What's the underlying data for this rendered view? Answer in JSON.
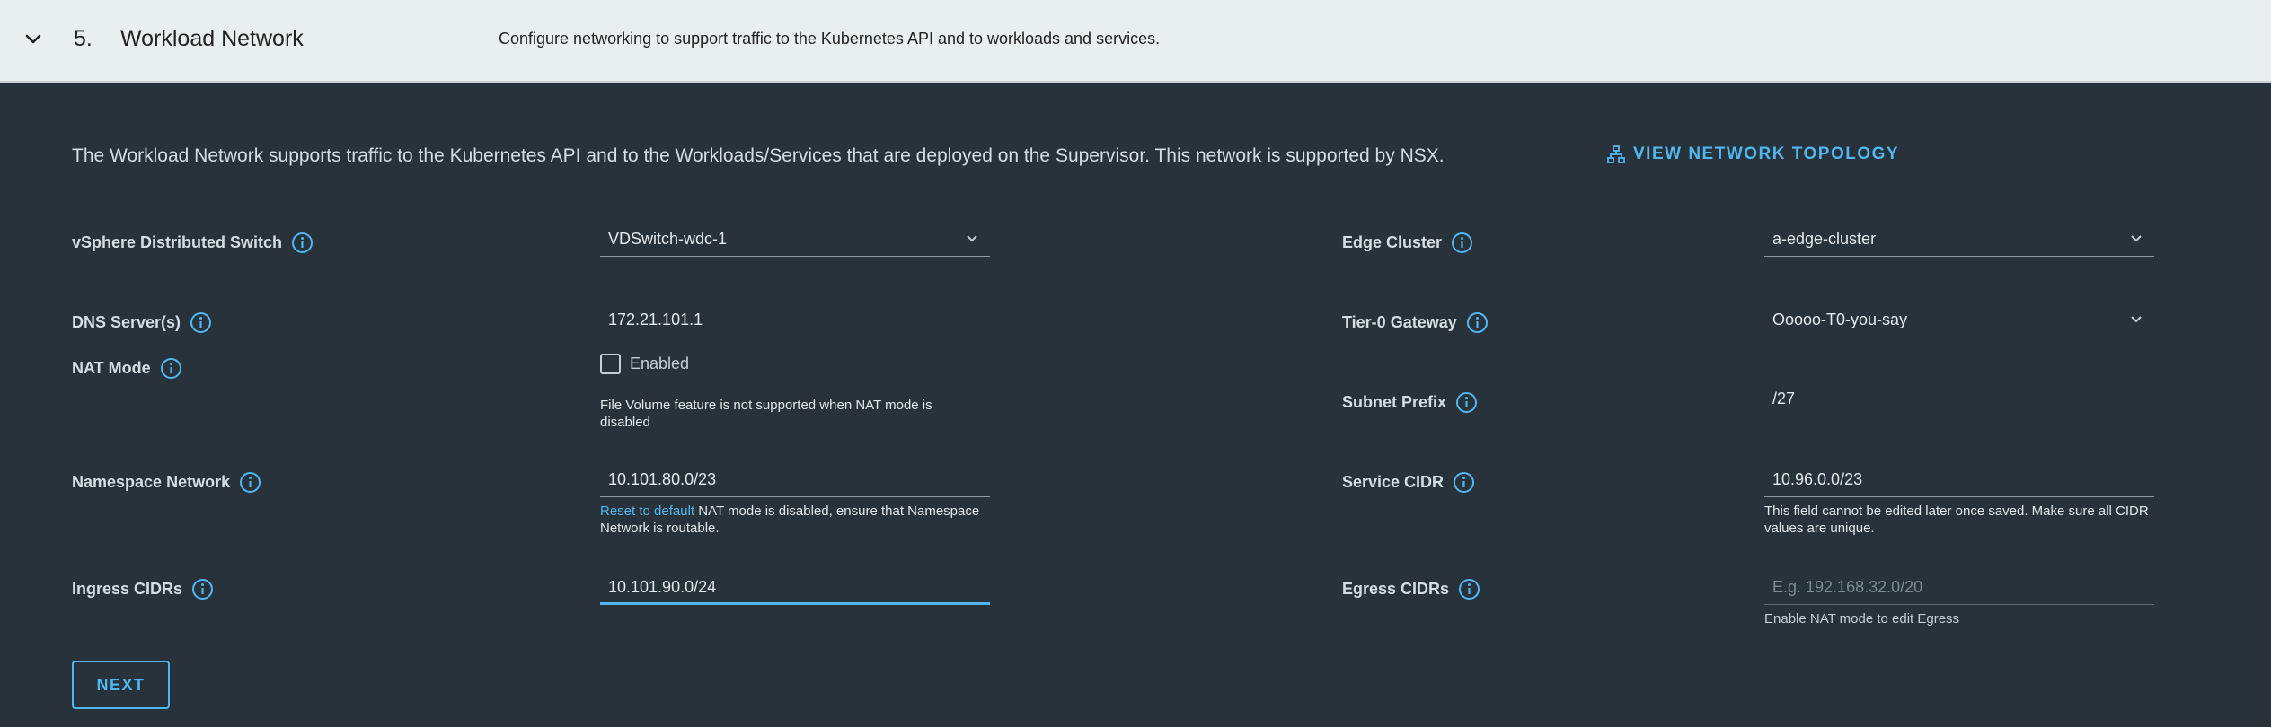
{
  "header": {
    "step_number": "5.",
    "step_title": "Workload Network",
    "step_description": "Configure networking to support traffic to the Kubernetes API and to workloads and services."
  },
  "intro": {
    "text": "The Workload Network supports traffic to the Kubernetes API and to the Workloads/Services that are deployed on the Supervisor. This network is supported by NSX.",
    "topology_link": "VIEW NETWORK TOPOLOGY"
  },
  "left": {
    "vds": {
      "label": "vSphere Distributed Switch",
      "value": "VDSwitch-wdc-1"
    },
    "dns": {
      "label": "DNS Server(s)",
      "value": "172.21.101.1"
    },
    "nat": {
      "label": "NAT Mode",
      "checkbox_label": "Enabled",
      "checked": false,
      "helper": "File Volume feature is not supported when NAT mode is disabled"
    },
    "namespace": {
      "label": "Namespace Network",
      "value": "10.101.80.0/23",
      "reset_link": "Reset to default",
      "helper": "NAT mode is disabled, ensure that Namespace Network is routable."
    },
    "ingress": {
      "label": "Ingress CIDRs",
      "value": "10.101.90.0/24"
    }
  },
  "right": {
    "edge": {
      "label": "Edge Cluster",
      "value": "a-edge-cluster"
    },
    "tier0": {
      "label": "Tier-0 Gateway",
      "value": "Ooooo-T0-you-say"
    },
    "subnet": {
      "label": "Subnet Prefix",
      "value": "/27"
    },
    "service": {
      "label": "Service CIDR",
      "value": "10.96.0.0/23",
      "helper": "This field cannot be edited later once saved. Make sure all CIDR values are unique."
    },
    "egress": {
      "label": "Egress CIDRs",
      "placeholder": "E.g. 192.168.32.0/20",
      "helper": "Enable NAT mode to edit Egress"
    }
  },
  "actions": {
    "next_label": "NEXT"
  },
  "colors": {
    "background": "#27323a",
    "header_bg": "#e9eef1",
    "accent": "#52b7f0",
    "text": "#e3e8eb"
  }
}
